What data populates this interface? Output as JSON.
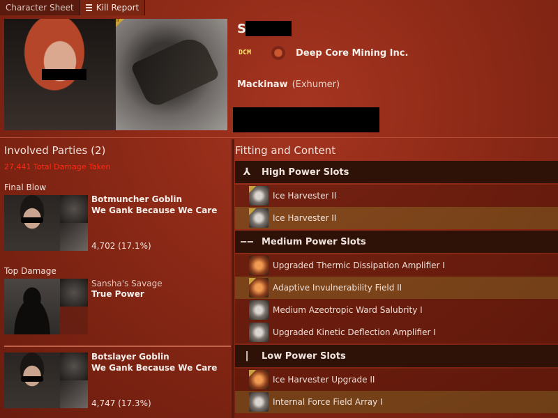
{
  "tabs": [
    {
      "label": "Character Sheet"
    },
    {
      "label": "Kill Report"
    }
  ],
  "victim": {
    "name_visible": "S",
    "corp_logo_text": "DCM",
    "corporation": "Deep Core Mining Inc.",
    "ship": "Mackinaw",
    "ship_class": "(Exhumer)"
  },
  "involved": {
    "title": "Involved Parties (2)",
    "total_damage": "27,441 Total Damage Taken",
    "final_blow_label": "Final Blow",
    "top_damage_label": "Top Damage",
    "parties": [
      {
        "name": "Botmuncher Goblin",
        "corp": "We Gank Because We Care",
        "damage": "4,702 (17.1%)"
      },
      {
        "name": "Sansha's Savage",
        "corp": "True Power",
        "damage": ""
      },
      {
        "name": "Botslayer Goblin",
        "corp": "We Gank Because We Care",
        "damage": "4,747 (17.3%)"
      }
    ]
  },
  "fitting": {
    "title": "Fitting and Content",
    "high": {
      "label": "High Power Slots",
      "items": [
        "Ice Harvester II",
        "Ice Harvester II"
      ]
    },
    "medium": {
      "label": "Medium Power Slots",
      "items": [
        "Upgraded Thermic Dissipation Amplifier I",
        "Adaptive Invulnerability Field II",
        "Medium Azeotropic Ward Salubrity I",
        "Upgraded Kinetic Deflection Amplifier I"
      ]
    },
    "low": {
      "label": "Low Power Slots",
      "items": [
        "Ice Harvester Upgrade II",
        "Internal Force Field Array I"
      ]
    }
  }
}
